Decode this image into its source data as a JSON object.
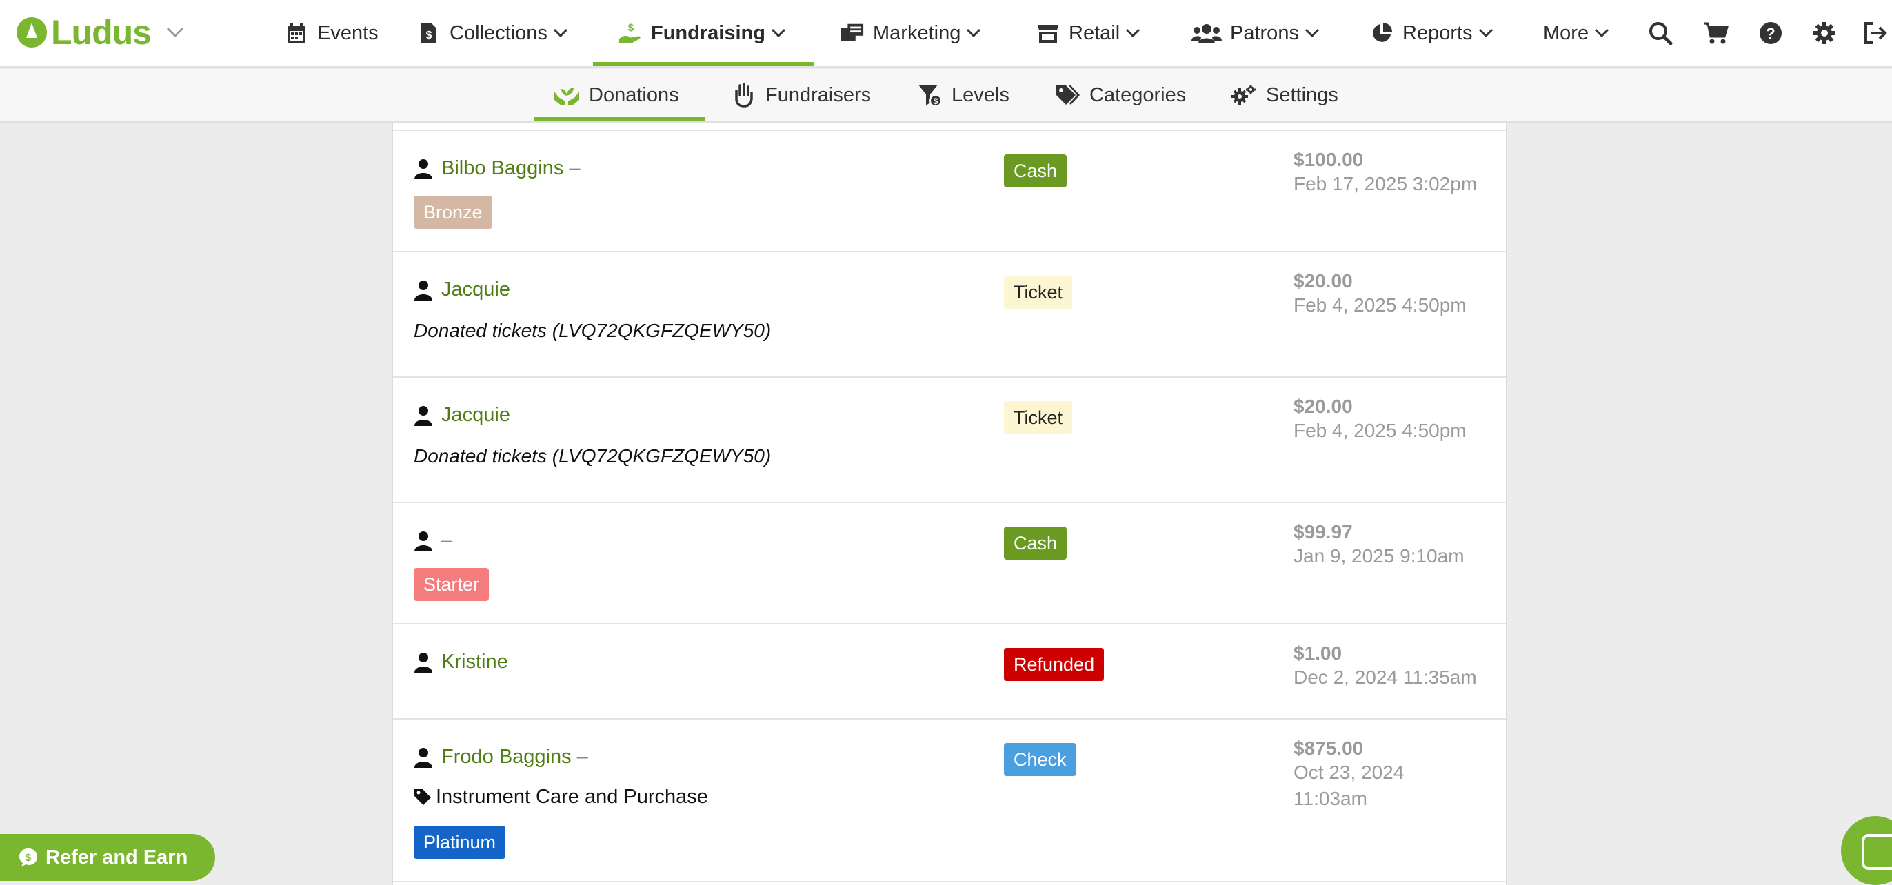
{
  "brand": {
    "name": "Ludus",
    "color": "#7ab62f"
  },
  "nav": {
    "items": [
      {
        "label": "Events",
        "icon": "calendar-icon"
      },
      {
        "label": "Collections",
        "icon": "dollar-file-icon"
      },
      {
        "label": "Fundraising",
        "icon": "hand-donation-icon",
        "active": true
      },
      {
        "label": "Marketing",
        "icon": "mailbox-icon"
      },
      {
        "label": "Retail",
        "icon": "store-icon"
      },
      {
        "label": "Patrons",
        "icon": "users-icon"
      },
      {
        "label": "Reports",
        "icon": "pie-chart-icon"
      },
      {
        "label": "More"
      }
    ],
    "utility_icons": [
      "search-icon",
      "cart-icon",
      "help-icon",
      "gear-icon",
      "sign-out-icon"
    ]
  },
  "subnav": {
    "items": [
      {
        "label": "Donations",
        "icon": "hands-plant-icon",
        "active": true
      },
      {
        "label": "Fundraisers",
        "icon": "raised-hand-icon"
      },
      {
        "label": "Levels",
        "icon": "filter-dollar-icon"
      },
      {
        "label": "Categories",
        "icon": "tags-icon"
      },
      {
        "label": "Settings",
        "icon": "gears-icon"
      }
    ]
  },
  "donations": [
    {
      "patron": "Bilbo Baggins",
      "dash": "–",
      "level": "Bronze",
      "level_color": "#d4b8a4",
      "payment": "Cash",
      "amount": "$100.00",
      "date": "Feb 17, 2025 3:02pm"
    },
    {
      "patron": "Jacquie",
      "note": "Donated tickets (LVQ72QKGFZQEWY50)",
      "payment": "Ticket",
      "amount": "$20.00",
      "date": "Feb 4, 2025 4:50pm"
    },
    {
      "patron": "Jacquie",
      "note": "Donated tickets (LVQ72QKGFZQEWY50)",
      "payment": "Ticket",
      "amount": "$20.00",
      "date": "Feb 4, 2025 4:50pm"
    },
    {
      "patron": "",
      "dash": "–",
      "level": "Starter",
      "level_color": "#f47c7c",
      "payment": "Cash",
      "amount": "$99.97",
      "date": "Jan 9, 2025 9:10am"
    },
    {
      "patron": "Kristine",
      "payment": "Refunded",
      "amount": "$1.00",
      "date": "Dec 2, 2024 11:35am"
    },
    {
      "patron": "Frodo Baggins",
      "dash": "–",
      "category": "Instrument Care and Purchase",
      "level": "Platinum",
      "level_color": "#1565c8",
      "payment": "Check",
      "amount": "$875.00",
      "date": "Oct 23, 2024 11:03am"
    }
  ],
  "payment_colors": {
    "Cash": "#6b9a22",
    "Ticket": "#fdf6d3",
    "Refunded": "#cc0000",
    "Check": "#4a9fe0"
  },
  "refer": {
    "label": "Refer and Earn"
  }
}
